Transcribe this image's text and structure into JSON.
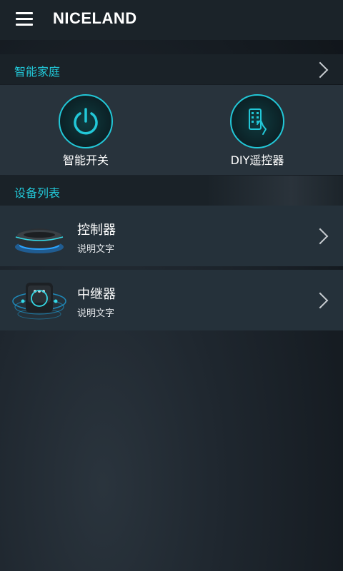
{
  "app": {
    "title": "NICELAND"
  },
  "smart_home": {
    "header": "智能家庭",
    "items": [
      {
        "label": "智能开关",
        "icon": "power-icon"
      },
      {
        "label": "DIY遥控器",
        "icon": "remote-control-icon"
      }
    ]
  },
  "device_list": {
    "header": "设备列表",
    "items": [
      {
        "title": "控制器",
        "subtitle": "说明文字",
        "icon": "controller-device-icon"
      },
      {
        "title": "中继器",
        "subtitle": "说明文字",
        "icon": "repeater-device-icon"
      }
    ]
  },
  "colors": {
    "accent": "#22c8d8",
    "header_bg": "#1b2329",
    "row_bg": "#25313a"
  }
}
